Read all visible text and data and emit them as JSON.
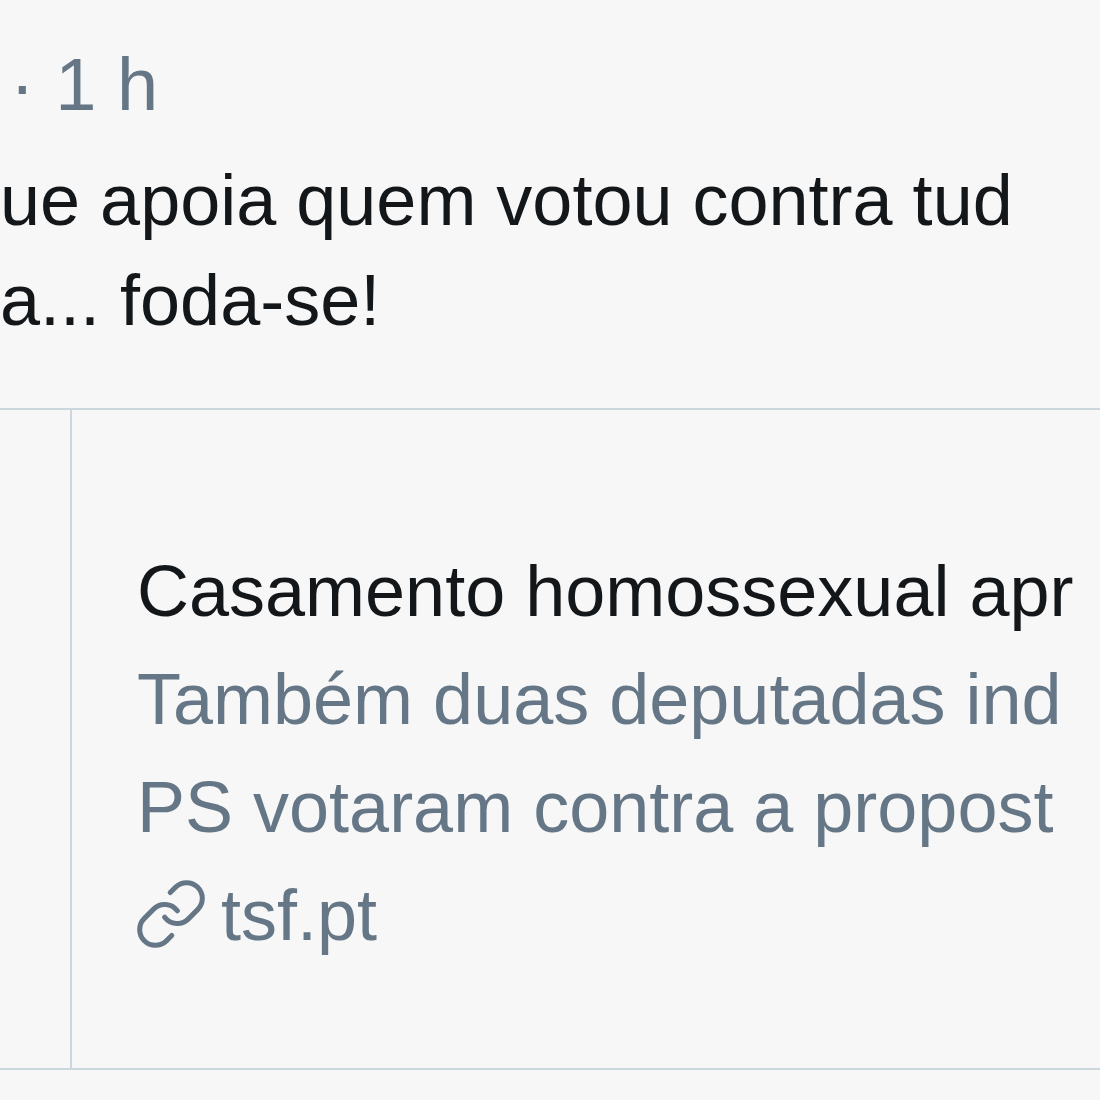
{
  "tweet": {
    "meta": "· 1 h",
    "text_lines": [
      "ue apoia quem votou contra tud",
      "a... foda-se!"
    ],
    "link_card": {
      "title": "Casamento homossexual apr",
      "description_lines": [
        "Também duas deputadas ind",
        "PS votaram contra a propost"
      ],
      "domain": "tsf.pt"
    }
  }
}
